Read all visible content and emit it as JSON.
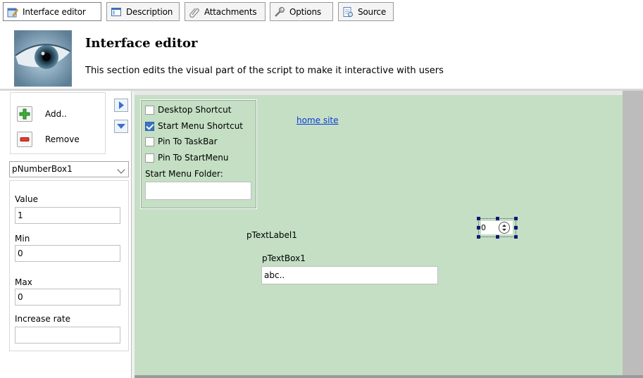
{
  "tabs": [
    {
      "label": "Interface editor",
      "icon": "interface-editor-icon",
      "active": true
    },
    {
      "label": "Description",
      "icon": "description-icon",
      "active": false
    },
    {
      "label": "Attachments",
      "icon": "paperclip-icon",
      "active": false
    },
    {
      "label": "Options",
      "icon": "wrench-icon",
      "active": false
    },
    {
      "label": "Source",
      "icon": "source-icon",
      "active": false
    }
  ],
  "header": {
    "title": "Interface editor",
    "description": "This section edits the visual part of the script to make it interactive with users",
    "image": "eye-icon"
  },
  "left_panel": {
    "add_label": "Add..",
    "remove_label": "Remove",
    "selected_component": "pNumberBox1",
    "properties": [
      {
        "label": "Value",
        "value": "1"
      },
      {
        "label": "Min",
        "value": "0"
      },
      {
        "label": "Max",
        "value": "0"
      },
      {
        "label": "Increase rate",
        "value": ""
      }
    ]
  },
  "canvas": {
    "background": "#c4dfc4",
    "checkboxes": [
      {
        "label": "Desktop Shortcut",
        "checked": false
      },
      {
        "label": "Start Menu Shortcut",
        "checked": true
      },
      {
        "label": "Pin To TaskBar",
        "checked": false
      },
      {
        "label": "Pin To StartMenu",
        "checked": false
      }
    ],
    "folder_label": "Start Menu Folder:",
    "folder_value": "",
    "link_text": "home site",
    "text_label_1": "pTextLabel1",
    "text_box_label": "pTextBox1",
    "text_box_value": "abc..",
    "number_box_value": "0"
  }
}
